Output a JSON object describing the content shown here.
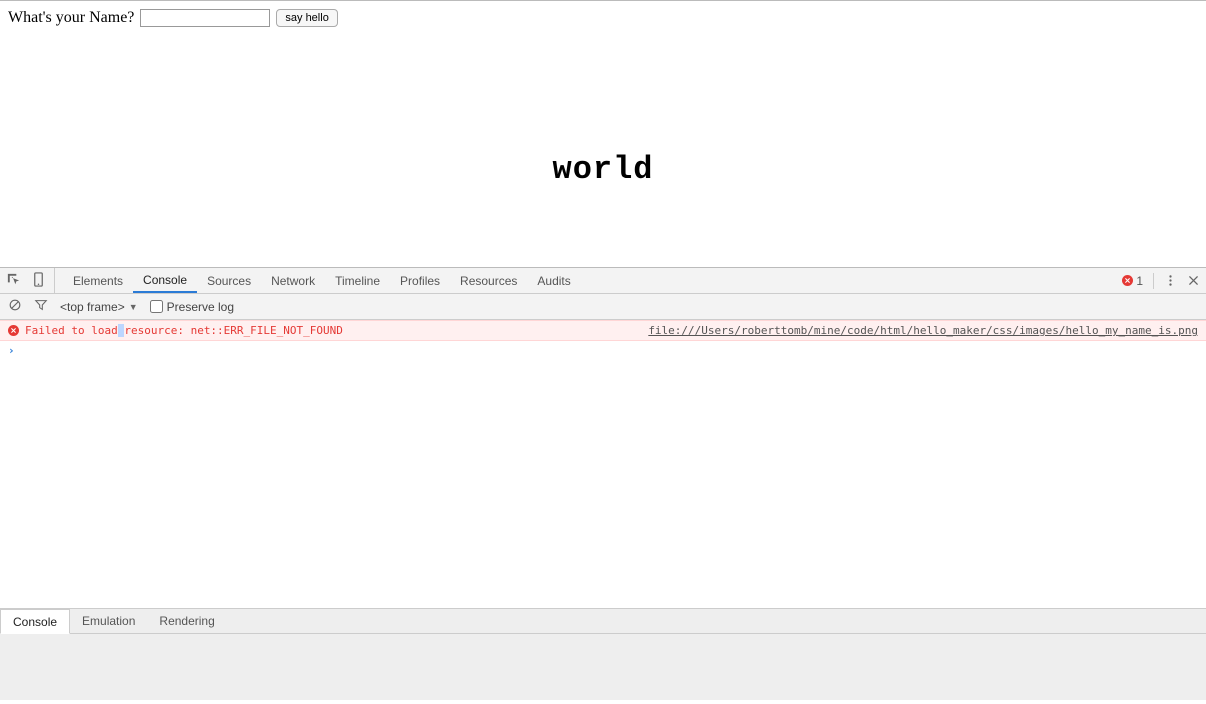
{
  "page": {
    "label": "What's your Name?",
    "input_value": "",
    "button_label": "say hello",
    "output": "world"
  },
  "devtools": {
    "tabs": {
      "elements": "Elements",
      "console": "Console",
      "sources": "Sources",
      "network": "Network",
      "timeline": "Timeline",
      "profiles": "Profiles",
      "resources": "Resources",
      "audits": "Audits"
    },
    "error_count": "1",
    "toolbar": {
      "frame_selector": "<top frame>",
      "preserve_log_label": "Preserve log",
      "preserve_log_checked": false
    },
    "console": {
      "error_prefix": "Failed to load",
      "error_highlight": " ",
      "error_suffix": "resource: net::ERR_FILE_NOT_FOUND",
      "error_source": "file:///Users/roberttomb/mine/code/html/hello_maker/css/images/hello_my_name_is.png"
    },
    "drawer": {
      "console": "Console",
      "emulation": "Emulation",
      "rendering": "Rendering"
    }
  }
}
